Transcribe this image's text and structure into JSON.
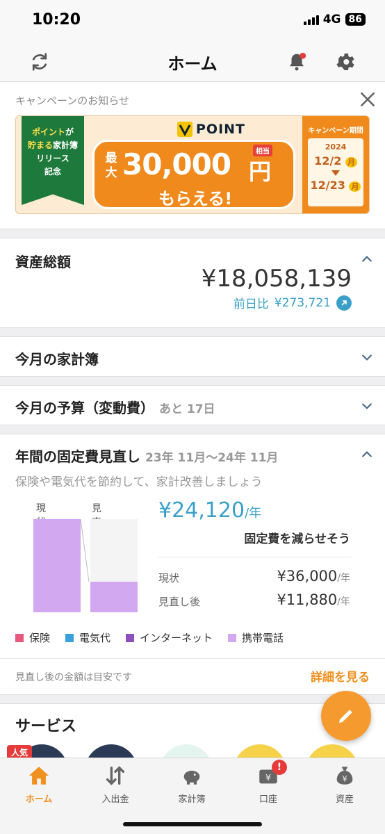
{
  "status": {
    "time": "10:20",
    "network": "4G",
    "battery": "86"
  },
  "nav": {
    "title": "ホーム",
    "sync_icon": "sync-icon",
    "bell_icon": "bell-icon",
    "settings_icon": "gear-icon",
    "notification_dot_color": "#e63b3b"
  },
  "campaign": {
    "title": "キャンペーンのお知らせ",
    "flag": {
      "line1_hl": "ポイント",
      "line1_rest": "が",
      "line2_hl": "貯まる",
      "line2_rest": "家計簿",
      "line3": "リリース",
      "line4": "記念"
    },
    "brand": "POINT",
    "max_label": "最大",
    "amount": "30,000",
    "yen": "円",
    "equiv_tag": "相当",
    "sub": "もらえる!",
    "period_title": "キャンペーン期間",
    "year": "2024",
    "start": "12/2",
    "start_day": "月",
    "end": "12/23",
    "end_day": "月",
    "colors": {
      "orange": "#f08a1c",
      "green": "#1d7a3c",
      "yellow": "#f6c300"
    }
  },
  "assets": {
    "title": "資産総額",
    "total": "¥18,058,139",
    "diff_label": "前日比",
    "diff_value": "¥273,721"
  },
  "monthly_book": {
    "title": "今月の家計簿"
  },
  "budget": {
    "title": "今月の予算（変動費）",
    "remaining": "あと 17日"
  },
  "fixed_costs": {
    "title": "年間の固定費見直し",
    "range": "23年 11月〜24年 11月",
    "subtitle": "保険や電気代を節約して、家計改善しましょう",
    "current_label": "現状",
    "after_label": "見直し後",
    "savings": "¥24,120",
    "per_year": "/年",
    "savings_note": "固定費を減らせそう",
    "current_value": "¥36,000",
    "after_value": "¥11,880",
    "current_ratio": 1.0,
    "after_ratio": 0.33,
    "legend": [
      {
        "label": "保険",
        "color": "#e8577e"
      },
      {
        "label": "電気代",
        "color": "#3aa0d8"
      },
      {
        "label": "インターネット",
        "color": "#8e4fbf"
      },
      {
        "label": "携帯電話",
        "color": "#d2a9f1"
      }
    ],
    "footnote": "見直し後の金額は目安です",
    "detail_link": "詳細を見る"
  },
  "services": {
    "title": "サービス",
    "popular_badge": "人気"
  },
  "tabs": [
    {
      "label": "ホーム",
      "icon": "home-icon",
      "active": true
    },
    {
      "label": "入出金",
      "icon": "transfer-icon",
      "active": false
    },
    {
      "label": "家計簿",
      "icon": "piggy-bank-icon",
      "active": false
    },
    {
      "label": "口座",
      "icon": "wallet-icon",
      "active": false,
      "badge": "!"
    },
    {
      "label": "資産",
      "icon": "money-bag-icon",
      "active": false
    }
  ]
}
